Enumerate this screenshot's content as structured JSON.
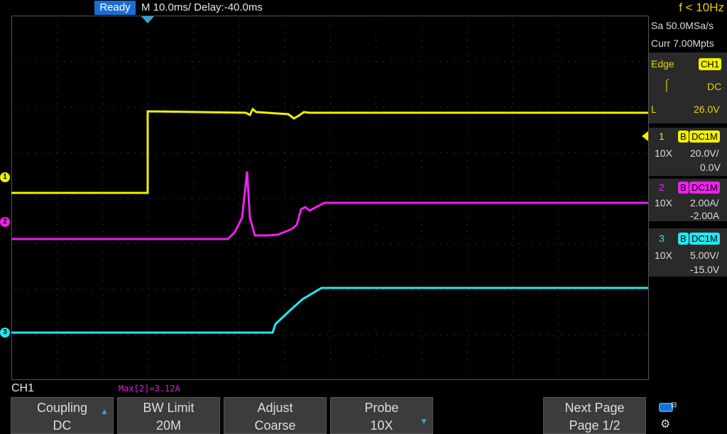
{
  "header": {
    "status": "Ready",
    "timebase": "M 10.0ms/ Delay:-40.0ms",
    "trigger_frequency": "f < 10Hz"
  },
  "acquisition": {
    "sample_rate": "Sa 50.0MSa/s",
    "memory_depth": "Curr 7.00Mpts"
  },
  "trigger": {
    "type": "Edge",
    "source": "CH1",
    "coupling": "DC",
    "level_label": "L",
    "level": "26.0V"
  },
  "channels": [
    {
      "number": "1",
      "bw_tag": "B",
      "coupling": "DC1M",
      "probe": "10X",
      "scale": "20.0V/",
      "offset": "0.0V",
      "color": "#f0f000"
    },
    {
      "number": "2",
      "bw_tag": "B",
      "coupling": "DC1M",
      "probe": "10X",
      "scale": "2.00A/",
      "offset": "-2.00A",
      "color": "#f020f0"
    },
    {
      "number": "3",
      "bw_tag": "B",
      "coupling": "DC1M",
      "probe": "10X",
      "scale": "5.00V/",
      "offset": "-15.0V",
      "color": "#20e8f0"
    }
  ],
  "waveform_markers": [
    "1",
    "2",
    "3"
  ],
  "active_channel": "CH1",
  "measurement": "Max[2]=3.12A",
  "softkeys": [
    {
      "label": "Coupling",
      "value": "DC"
    },
    {
      "label": "BW Limit",
      "value": "20M"
    },
    {
      "label": "Adjust",
      "value": "Coarse"
    },
    {
      "label": "Probe",
      "value": "10X"
    },
    {
      "label": "Next Page",
      "value": "Page 1/2"
    }
  ],
  "icons": {
    "arrow": "up-arrow-icon",
    "down": "down-arrow-icon",
    "usb": "usb-icon",
    "network": "network-icon"
  }
}
